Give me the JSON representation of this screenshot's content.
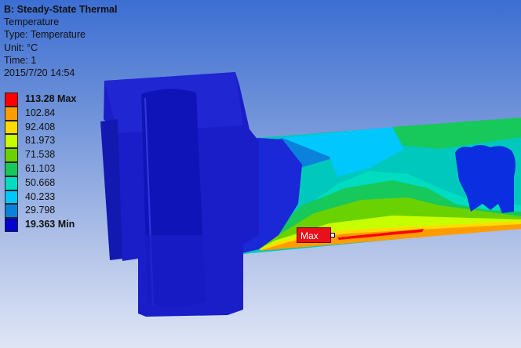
{
  "result": {
    "title": "B: Steady-State Thermal",
    "quantity": "Temperature",
    "type_line": "Type: Temperature",
    "unit_line": "Unit: °C",
    "time_line": "Time: 1",
    "date_line": "2015/7/20 14:54"
  },
  "legend": {
    "levels": [
      {
        "label": "113.28 Max",
        "color": "#ff0000",
        "bold": true
      },
      {
        "label": "102.84",
        "color": "#ff9d00",
        "bold": false
      },
      {
        "label": "92.408",
        "color": "#ffdc00",
        "bold": false
      },
      {
        "label": "81.973",
        "color": "#c8ff00",
        "bold": false
      },
      {
        "label": "71.538",
        "color": "#6ad200",
        "bold": false
      },
      {
        "label": "61.103",
        "color": "#17c85a",
        "bold": false
      },
      {
        "label": "50.668",
        "color": "#00dcc0",
        "bold": false
      },
      {
        "label": "40.233",
        "color": "#00c8ff",
        "bold": false
      },
      {
        "label": "29.798",
        "color": "#0a82dc",
        "bold": false
      },
      {
        "label": "19.363 Min",
        "color": "#0000d0",
        "bold": true
      }
    ]
  },
  "probe": {
    "label": "Max",
    "color": "#e8101a"
  },
  "icons": {
    "probe_marker": "probe-pin-icon"
  }
}
